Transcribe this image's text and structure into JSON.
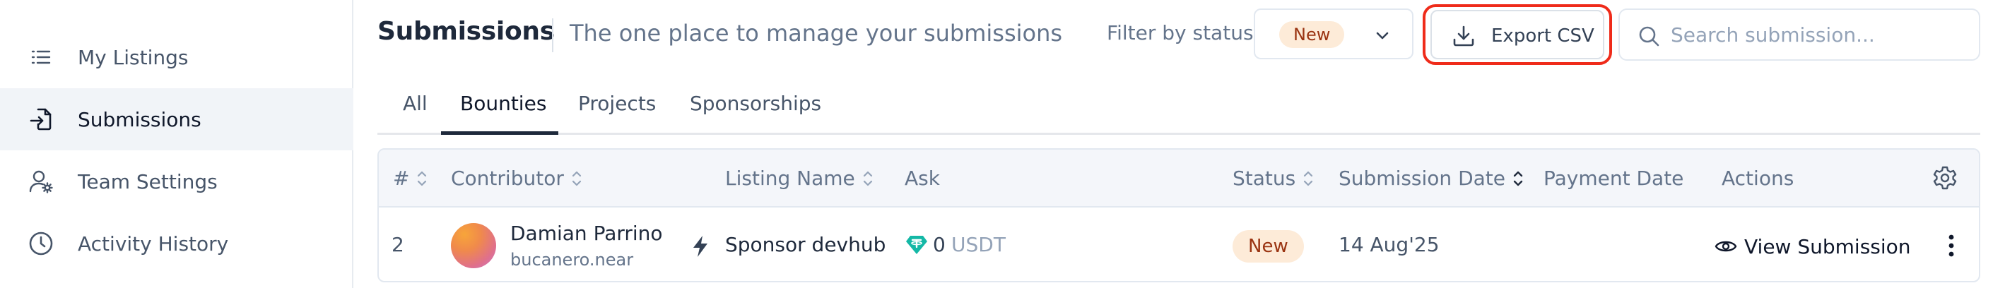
{
  "sidebar": {
    "items": [
      {
        "label": "My Listings",
        "icon": "list-icon",
        "active": false
      },
      {
        "label": "Submissions",
        "icon": "submissions-icon",
        "active": true
      },
      {
        "label": "Team Settings",
        "icon": "team-settings-icon",
        "active": false
      },
      {
        "label": "Activity History",
        "icon": "clock-icon",
        "active": false
      }
    ]
  },
  "header": {
    "title": "Submissions",
    "subtitle": "The one place to manage your submissions",
    "filter_label": "Filter by status",
    "filter_value": "New",
    "export_label": "Export CSV",
    "search_placeholder": "Search submission..."
  },
  "tabs": [
    {
      "label": "All",
      "active": false
    },
    {
      "label": "Bounties",
      "active": true
    },
    {
      "label": "Projects",
      "active": false
    },
    {
      "label": "Sponsorships",
      "active": false
    }
  ],
  "table": {
    "columns": [
      "#",
      "Contributor",
      "Listing Name",
      "Ask",
      "Status",
      "Submission Date",
      "Payment Date",
      "Actions"
    ],
    "rows": [
      {
        "index": "2",
        "contributor_name": "Damian Parrino",
        "contributor_handle": "bucanero.near",
        "listing_name": "Sponsor devhub",
        "ask_amount": "0",
        "ask_token": "USDT",
        "status": "New",
        "submission_date": "14 Aug'25",
        "payment_date": "",
        "action_label": "View Submission"
      }
    ]
  },
  "colors": {
    "accent_highlight": "#ef2b1a",
    "status_new_bg": "#fdebd8",
    "status_new_text": "#9a3412",
    "gem": "#14b8a6"
  }
}
